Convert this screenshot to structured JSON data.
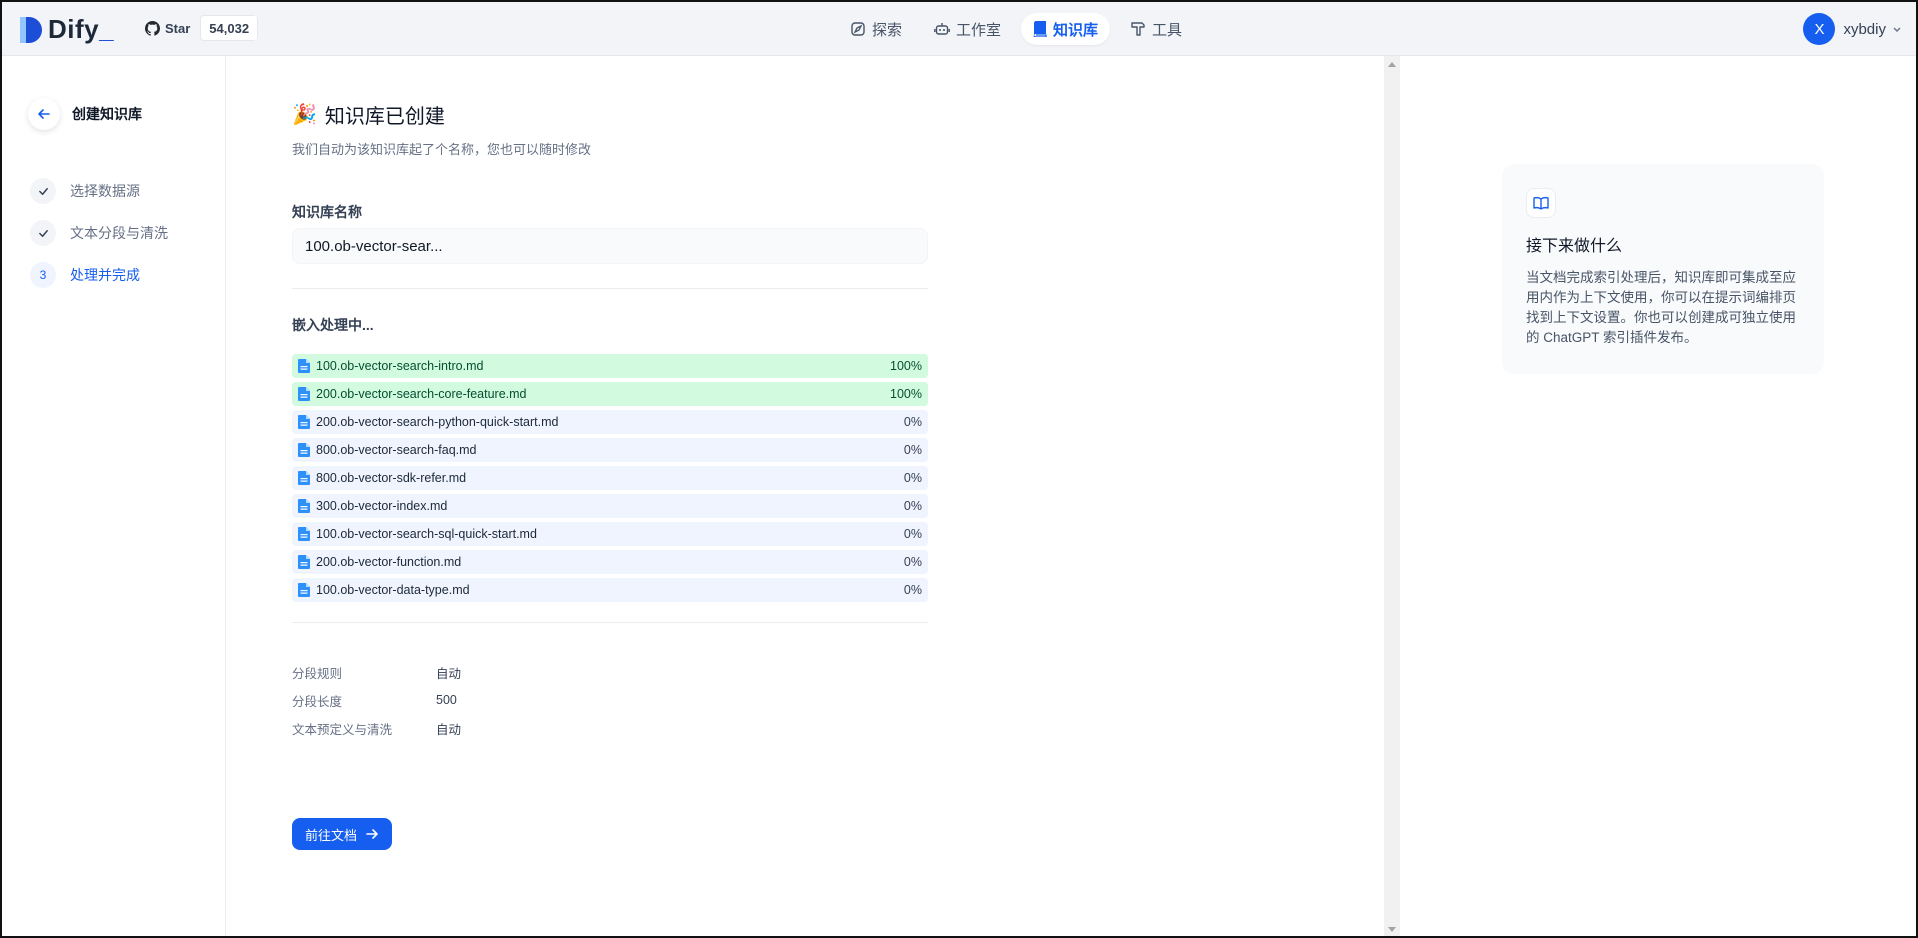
{
  "header": {
    "logo_text": "Dify",
    "logo_cursor": "_",
    "github": {
      "label": "Star",
      "count": "54,032"
    },
    "nav": [
      {
        "label": "探索",
        "icon": "compass-icon"
      },
      {
        "label": "工作室",
        "icon": "robot-icon"
      },
      {
        "label": "知识库",
        "icon": "book-icon",
        "active": true
      },
      {
        "label": "工具",
        "icon": "hammer-icon"
      }
    ],
    "user": {
      "initial": "X",
      "name": "xybdiy"
    }
  },
  "steps": {
    "back_title": "创建知识库",
    "items": [
      {
        "label": "选择数据源",
        "status": "done"
      },
      {
        "label": "文本分段与清洗",
        "status": "done"
      },
      {
        "number": "3",
        "label": "处理并完成",
        "status": "active"
      }
    ]
  },
  "main": {
    "title_emoji": "🎉",
    "title": "知识库已创建",
    "subtitle": "我们自动为该知识库起了个名称，您也可以随时修改",
    "name_label": "知识库名称",
    "name_value": "100.ob-vector-sear...",
    "embed_title": "嵌入处理中...",
    "files": [
      {
        "name": "100.ob-vector-search-intro.md",
        "progress": 100,
        "pct_label": "100%"
      },
      {
        "name": "200.ob-vector-search-core-feature.md",
        "progress": 100,
        "pct_label": "100%"
      },
      {
        "name": "200.ob-vector-search-python-quick-start.md",
        "progress": 0,
        "pct_label": "0%"
      },
      {
        "name": "800.ob-vector-search-faq.md",
        "progress": 0,
        "pct_label": "0%"
      },
      {
        "name": "800.ob-vector-sdk-refer.md",
        "progress": 0,
        "pct_label": "0%"
      },
      {
        "name": "300.ob-vector-index.md",
        "progress": 0,
        "pct_label": "0%"
      },
      {
        "name": "100.ob-vector-search-sql-quick-start.md",
        "progress": 0,
        "pct_label": "0%"
      },
      {
        "name": "200.ob-vector-function.md",
        "progress": 0,
        "pct_label": "0%"
      },
      {
        "name": "100.ob-vector-data-type.md",
        "progress": 0,
        "pct_label": "0%"
      }
    ],
    "rules": [
      {
        "key": "分段规则",
        "value": "自动"
      },
      {
        "key": "分段长度",
        "value": "500"
      },
      {
        "key": "文本预定义与清洗",
        "value": "自动"
      }
    ],
    "go_button": "前往文档"
  },
  "tip": {
    "title": "接下来做什么",
    "body": "当文档完成索引处理后，知识库即可集成至应用内作为上下文使用，你可以在提示词编排页找到上下文设置。你也可以创建成可独立使用的 ChatGPT 索引插件发布。"
  },
  "colors": {
    "accent": "#155eef",
    "progress_done": "#d1fadf",
    "progress_track": "#eff4ff"
  }
}
